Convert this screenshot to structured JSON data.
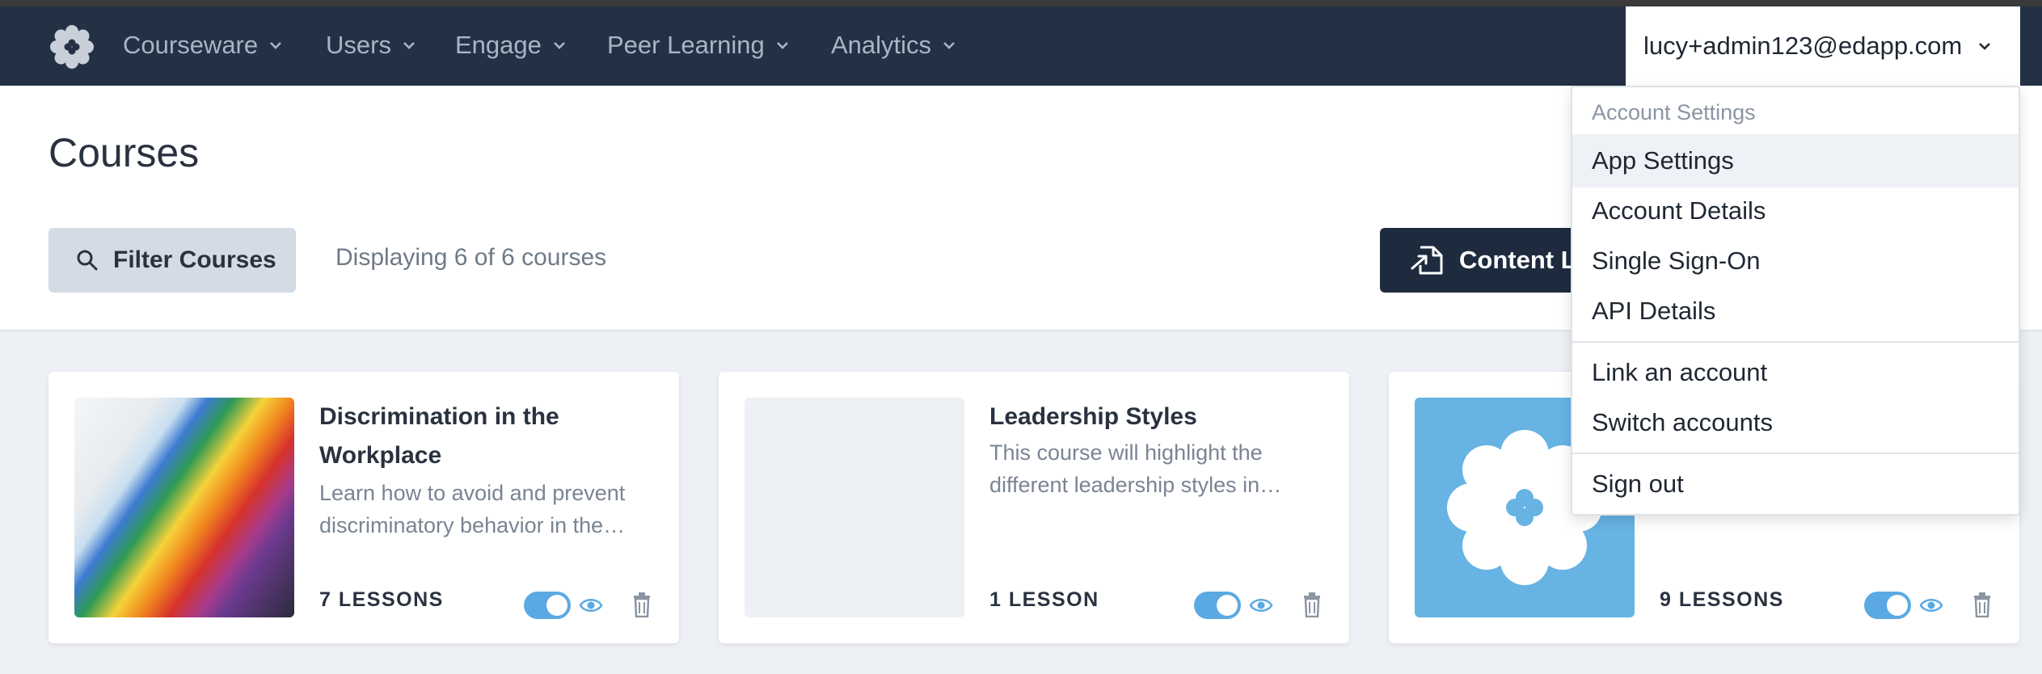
{
  "nav": {
    "items": [
      {
        "label": "Courseware"
      },
      {
        "label": "Users"
      },
      {
        "label": "Engage"
      },
      {
        "label": "Peer Learning"
      },
      {
        "label": "Analytics"
      }
    ],
    "account_email": "lucy+admin123@edapp.com"
  },
  "page": {
    "title": "Courses",
    "filter_label": "Filter Courses",
    "display_count": "Displaying 6 of 6 courses",
    "content_library_label": "Content Library"
  },
  "courses": [
    {
      "title": "Discrimination in the Workplace",
      "description": "Learn how to avoid and prevent discriminatory behavior in the…",
      "lessons": "7 LESSONS",
      "published": true
    },
    {
      "title": "Leadership Styles",
      "description": "This course will highlight the different leadership styles in…",
      "lessons": "1 LESSON",
      "published": true
    },
    {
      "title": "",
      "description": "",
      "lessons": "9 LESSONS",
      "published": true
    }
  ],
  "account_menu": {
    "header": "Account Settings",
    "items": [
      {
        "label": "App Settings"
      },
      {
        "label": "Account Details"
      },
      {
        "label": "Single Sign-On"
      },
      {
        "label": "API Details"
      },
      {
        "label": "Link an account"
      },
      {
        "label": "Switch accounts"
      },
      {
        "label": "Sign out"
      }
    ]
  },
  "colors": {
    "nav_bg": "#243044",
    "accent": "#5aa9e2",
    "primary_button": "#1e2b3f"
  }
}
